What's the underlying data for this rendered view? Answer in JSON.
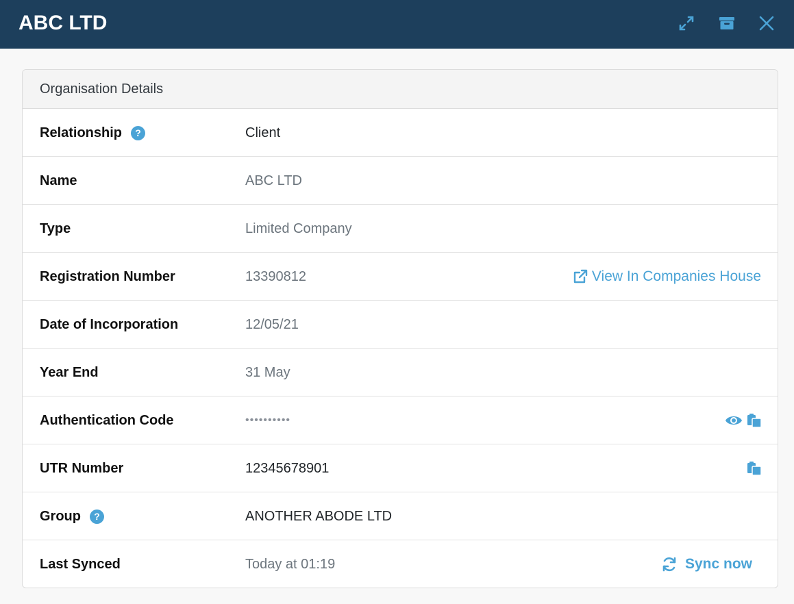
{
  "header": {
    "title": "ABC LTD",
    "icons": [
      "expand-icon",
      "archive-icon",
      "close-icon"
    ],
    "background": "#1d3f5c",
    "icon_color": "#4aa3d6"
  },
  "card": {
    "title": "Organisation Details",
    "rows": {
      "relationship": {
        "label": "Relationship",
        "value": "Client"
      },
      "name": {
        "label": "Name",
        "value": "ABC LTD"
      },
      "type": {
        "label": "Type",
        "value": "Limited Company"
      },
      "registration": {
        "label": "Registration Number",
        "value": "13390812",
        "link": "View In Companies House"
      },
      "incorporation": {
        "label": "Date of Incorporation",
        "value": "12/05/21"
      },
      "year_end": {
        "label": "Year End",
        "value": "31 May"
      },
      "auth_code": {
        "label": "Authentication Code",
        "value": "••••••••••"
      },
      "utr": {
        "label": "UTR Number",
        "value": "12345678901"
      },
      "group": {
        "label": "Group",
        "value": "ANOTHER ABODE LTD"
      },
      "last_synced": {
        "label": "Last Synced",
        "value": "Today at 01:19",
        "action": "Sync now"
      }
    }
  },
  "colors": {
    "accent": "#4aa3d6"
  }
}
